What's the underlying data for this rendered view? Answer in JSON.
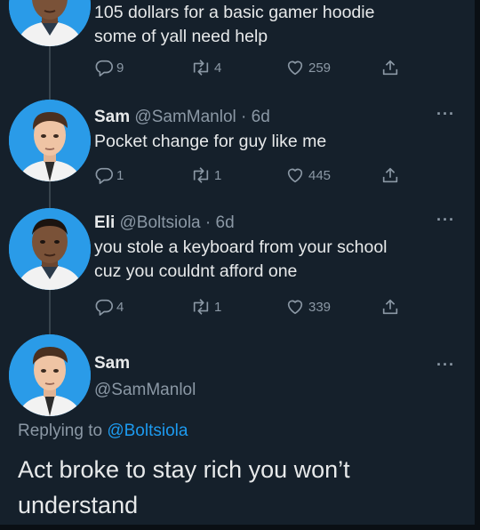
{
  "tweet1": {
    "text_line1": "105 dollars for a basic gamer hoodie",
    "text_line2": "some of yall need help",
    "replies": "9",
    "retweets": "4",
    "likes": "259"
  },
  "tweet2": {
    "name": "Sam",
    "handle": "@SamManlol",
    "time": "6d",
    "text": "Pocket change for guy like me",
    "replies": "1",
    "retweets": "1",
    "likes": "445"
  },
  "tweet3": {
    "name": "Eli",
    "handle": "@Boltsiola",
    "time": "6d",
    "text_line1": "you stole a keyboard from your school",
    "text_line2": "cuz you couldnt afford one",
    "replies": "4",
    "retweets": "1",
    "likes": "339"
  },
  "main_tweet": {
    "name": "Sam",
    "handle": "@SamManlol",
    "replying_prefix": "Replying to",
    "replying_to": "@Boltsiola",
    "text": "Act broke to stay rich you won’t understand"
  },
  "more_label": "···",
  "separator": "·",
  "colors": {
    "background": "#15202b",
    "muted": "#8b98a5",
    "accent": "#1d9bf0",
    "text": "#e7e9ea"
  },
  "icons": [
    "reply-icon",
    "retweet-icon",
    "like-icon",
    "share-icon",
    "more-icon"
  ]
}
